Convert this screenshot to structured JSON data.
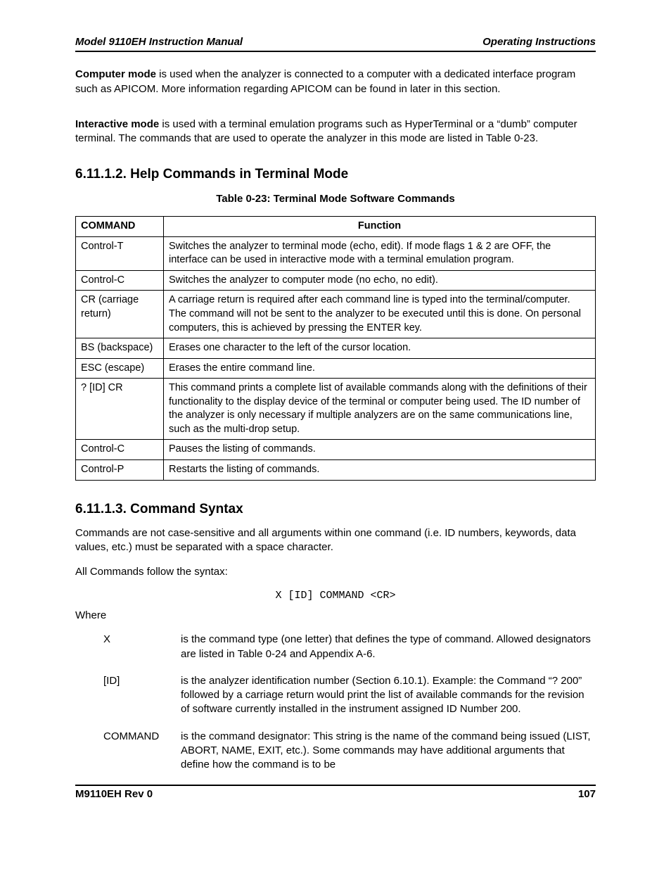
{
  "header": {
    "left": "Model 9110EH Instruction Manual",
    "right": "Operating Instructions"
  },
  "para1": {
    "bold": "Computer mode",
    "rest": " is used when the analyzer is connected to a computer with a dedicated interface program such as APICOM. More information regarding APICOM can be found in later in this section."
  },
  "para2": {
    "bold": "Interactive mode",
    "rest": " is used with a terminal emulation programs such as HyperTerminal or a “dumb” computer terminal. The commands that are used to operate the analyzer in this mode are listed in Table 0-23."
  },
  "heading1": "6.11.1.2. Help Commands in Terminal Mode",
  "tableCaption": "Table 0-23:  Terminal Mode Software Commands",
  "table": {
    "headers": [
      "COMMAND",
      "Function"
    ],
    "rows": [
      {
        "cmd": "Control-T",
        "fn": "Switches the analyzer to terminal mode (echo, edit). If mode flags 1 & 2 are OFF, the interface can be used in interactive mode with a terminal emulation program."
      },
      {
        "cmd": "Control-C",
        "fn": "Switches the analyzer to computer mode (no echo, no edit)."
      },
      {
        "cmd": "CR (carriage return)",
        "fn": "A carriage return is required after each command line is typed into the terminal/computer. The command will not be sent to the analyzer to be executed until this is done. On personal computers, this is achieved by pressing the ENTER key."
      },
      {
        "cmd": "BS (backspace)",
        "fn": "Erases one character to the left of the cursor location."
      },
      {
        "cmd": "ESC (escape)",
        "fn": "Erases the entire command line."
      },
      {
        "cmd": "? [ID] CR",
        "fn": "This command prints a complete list of available commands along with the definitions of their functionality to the display device of the terminal or computer being used. The ID number of the analyzer is only necessary if multiple analyzers are on the same communications line, such as the multi-drop setup."
      },
      {
        "cmd": "Control-C",
        "fn": "Pauses the listing of commands."
      },
      {
        "cmd": "Control-P",
        "fn": "Restarts the listing of commands."
      }
    ]
  },
  "heading2": "6.11.1.3. Command Syntax",
  "para3": "Commands are not case-sensitive and all arguments within one command (i.e. ID numbers, keywords, data values, etc.) must be separated with a space character.",
  "para4": "All Commands follow the syntax:",
  "syntax": "X [ID] COMMAND <CR>",
  "whereLabel": "Where",
  "defs": [
    {
      "term": "X",
      "desc": "is the command type (one letter) that defines the type of command. Allowed designators are listed in Table 0-24 and Appendix A-6."
    },
    {
      "term": "[ID]",
      "desc": "is the analyzer identification number (Section 6.10.1). Example: the Command “? 200” followed by a carriage return would print the list of available commands for the revision of software currently installed in the instrument assigned ID Number 200."
    },
    {
      "term": "COMMAND",
      "desc": "is the command designator: This string is the name of the command being issued (LIST, ABORT, NAME, EXIT, etc.). Some commands may have additional arguments that define how the command is to be"
    }
  ],
  "footer": {
    "left": "M9110EH Rev 0",
    "right": "107"
  }
}
